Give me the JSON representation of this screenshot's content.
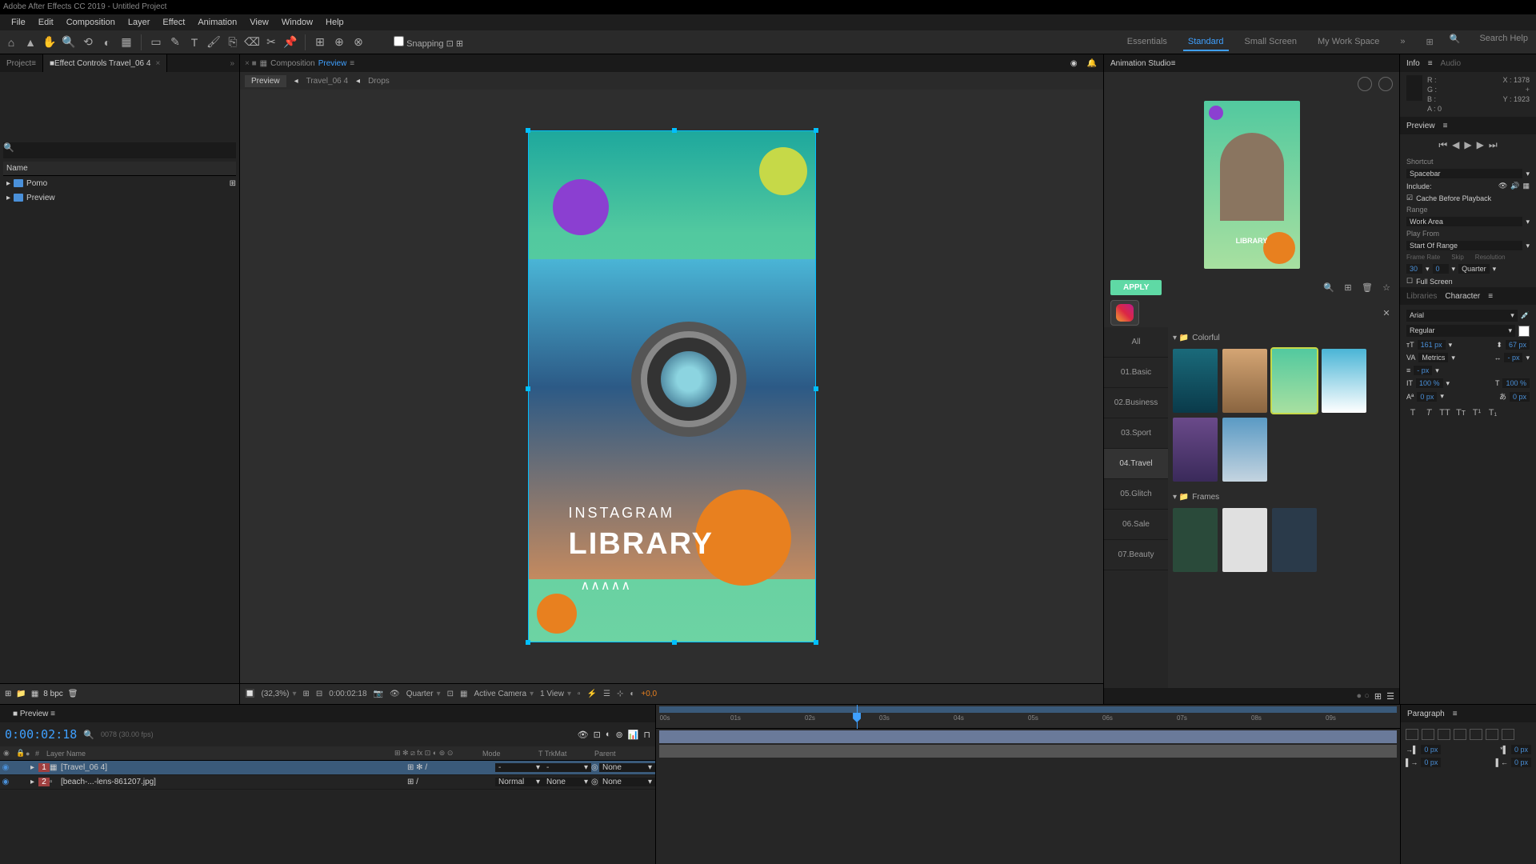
{
  "app_title": "Adobe After Effects CC 2019 - Untitled Project",
  "menus": [
    "File",
    "Edit",
    "Composition",
    "Layer",
    "Effect",
    "Animation",
    "View",
    "Window",
    "Help"
  ],
  "snapping": "Snapping",
  "workspaces": {
    "items": [
      "Essentials",
      "Standard",
      "Small Screen",
      "My Work Space"
    ],
    "active": "Standard"
  },
  "search_help": "Search Help",
  "project_tab": "Project",
  "effect_tab": "Effect Controls Travel_06 4",
  "project": {
    "header": "Name",
    "items": [
      "Pomo",
      "Preview"
    ],
    "bpc": "8 bpc"
  },
  "comp": {
    "tab_label": "Composition",
    "tab_name": "Preview",
    "crumbs": [
      "Preview",
      "Travel_06 4",
      "Drops"
    ]
  },
  "canvas": {
    "text1": "INSTAGRAM",
    "text2": "LIBRARY",
    "zigzag": "∧∧∧∧∧"
  },
  "viewer_footer": {
    "zoom": "(32,3%)",
    "time": "0:00:02:18",
    "quality": "Quarter",
    "camera": "Active Camera",
    "view": "1 View",
    "exposure": "+0,0"
  },
  "plugin": {
    "title": "Animation Studio",
    "apply": "APPLY",
    "categories": [
      "All",
      "01.Basic",
      "02.Business",
      "03.Sport",
      "04.Travel",
      "05.Glitch",
      "06.Sale",
      "07.Beauty"
    ],
    "active_cat": "04.Travel",
    "sections": [
      "Colorful",
      "Frames"
    ]
  },
  "info": {
    "tab1": "Info",
    "tab2": "Audio",
    "R": "R :",
    "G": "G :",
    "B": "B :",
    "A": "A : 0",
    "X": "X : 1378",
    "Y": "Y : 1923",
    "plus": "+"
  },
  "preview": {
    "tab": "Preview",
    "shortcut_label": "Shortcut",
    "shortcut": "Spacebar",
    "include": "Include:",
    "cache": "Cache Before Playback",
    "range_label": "Range",
    "range": "Work Area",
    "playfrom": "Play From",
    "playstart": "Start Of Range",
    "framerate_l": "Frame Rate",
    "skip_l": "Skip",
    "res_l": "Resolution",
    "framerate": "30",
    "skip": "0",
    "res": "Quarter",
    "fullscreen": "Full Screen"
  },
  "char": {
    "tab1": "Libraries",
    "tab2": "Character",
    "font": "Arial",
    "style": "Regular",
    "size": "161 px",
    "kerning": "67 px",
    "tracking": "Metrics",
    "leading": "- px",
    "hscale": "100 %",
    "vscale": "100 %",
    "baseline": "0 px",
    "tsume": "0 px"
  },
  "timeline": {
    "tab": "Preview",
    "timecode": "0:00:02:18",
    "fps": "0078 (30.00 fps)",
    "columns": {
      "layer_name": "Layer Name",
      "mode": "Mode",
      "trkmat": "TrkMat",
      "parent": "Parent"
    },
    "layers": [
      {
        "num": "1",
        "name": "[Travel_06 4]",
        "mode": "",
        "trk": "",
        "parent": "None"
      },
      {
        "num": "2",
        "name": "[beach-...-lens-861207.jpg]",
        "mode": "Normal",
        "trk": "None",
        "parent": "None"
      }
    ],
    "ruler": [
      "00s",
      "01s",
      "02s",
      "03s",
      "04s",
      "05s",
      "06s",
      "07s",
      "08s",
      "09s"
    ]
  },
  "paragraph": {
    "tab": "Paragraph",
    "indent": "0 px"
  }
}
